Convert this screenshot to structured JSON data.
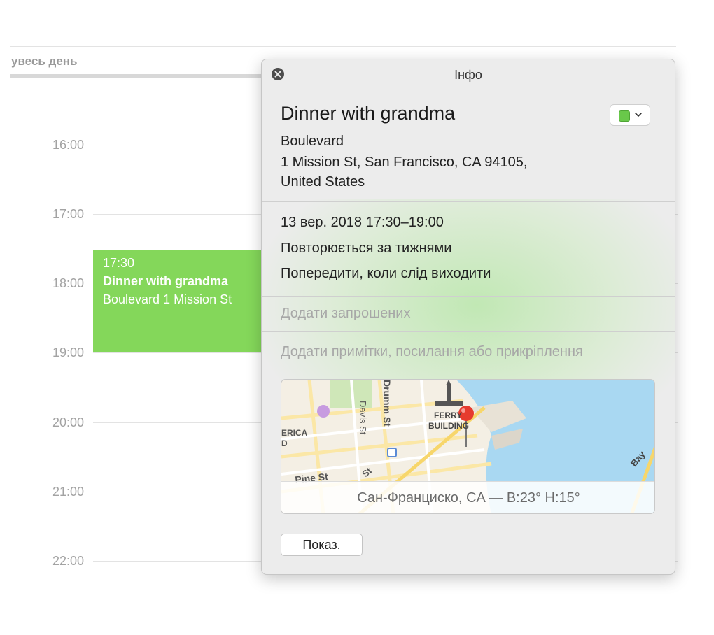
{
  "calendar": {
    "all_day_label": "увесь день",
    "hours": [
      "16:00",
      "17:00",
      "18:00",
      "19:00",
      "20:00",
      "21:00",
      "22:00"
    ],
    "event": {
      "time": "17:30",
      "title": "Dinner with grandma",
      "location": "Boulevard 1 Mission St",
      "color": "#84d75a"
    }
  },
  "popover": {
    "window_title": "Інфо",
    "close_icon": "close-icon",
    "event_title": "Dinner with grandma",
    "calendar_color": "#69c84a",
    "address_lines": [
      "Boulevard",
      "1 Mission St, San Francisco, CA  94105,",
      "United States"
    ],
    "datetime": "13 вер. 2018  17:30–19:00",
    "repeat": "Повторюється за тижнями",
    "travel_alert": "Попередити, коли слід виходити",
    "add_invitees": "Додати запрошених",
    "add_notes": "Додати примітки, посилання або прикріплення",
    "map": {
      "labels": {
        "drumm": "Drumm St",
        "davis": "Davis St",
        "pine": "Pine St",
        "ferry1": "FERRY",
        "ferry2": "BUILDING",
        "erica": "ERICA",
        "d": "D",
        "bay": "Bay",
        "st": "St"
      },
      "weather": "Сан-Франциско, CA — В:23°  Н:15°"
    },
    "show_button": "Показ."
  }
}
